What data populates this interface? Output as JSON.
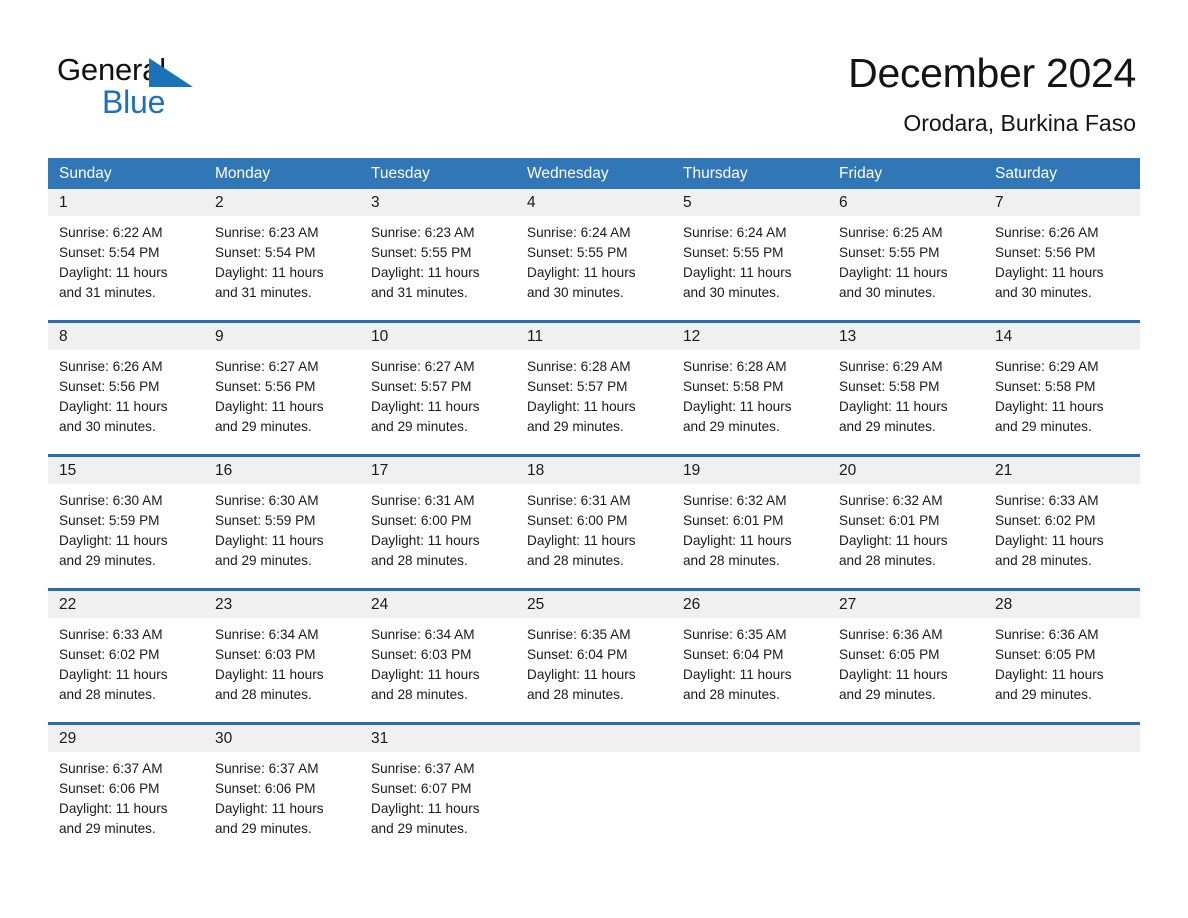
{
  "brand": {
    "word_black": "General",
    "word_blue": "Blue",
    "triangle_color": "#1b72b8",
    "logo_icon": "general-blue-triangle-logo"
  },
  "header": {
    "title": "December 2024",
    "subtitle": "Orodara, Burkina Faso"
  },
  "theme": {
    "header_blue": "#3176b6",
    "row_divider_blue": "#2b6cad",
    "day_band_gray": "#f0f0f0",
    "text": "#1a1a1a"
  },
  "weekdays": [
    "Sunday",
    "Monday",
    "Tuesday",
    "Wednesday",
    "Thursday",
    "Friday",
    "Saturday"
  ],
  "weeks": [
    [
      {
        "day": "1",
        "sunrise": "Sunrise: 6:22 AM",
        "sunset": "Sunset: 5:54 PM",
        "daylight_1": "Daylight: 11 hours",
        "daylight_2": "and 31 minutes."
      },
      {
        "day": "2",
        "sunrise": "Sunrise: 6:23 AM",
        "sunset": "Sunset: 5:54 PM",
        "daylight_1": "Daylight: 11 hours",
        "daylight_2": "and 31 minutes."
      },
      {
        "day": "3",
        "sunrise": "Sunrise: 6:23 AM",
        "sunset": "Sunset: 5:55 PM",
        "daylight_1": "Daylight: 11 hours",
        "daylight_2": "and 31 minutes."
      },
      {
        "day": "4",
        "sunrise": "Sunrise: 6:24 AM",
        "sunset": "Sunset: 5:55 PM",
        "daylight_1": "Daylight: 11 hours",
        "daylight_2": "and 30 minutes."
      },
      {
        "day": "5",
        "sunrise": "Sunrise: 6:24 AM",
        "sunset": "Sunset: 5:55 PM",
        "daylight_1": "Daylight: 11 hours",
        "daylight_2": "and 30 minutes."
      },
      {
        "day": "6",
        "sunrise": "Sunrise: 6:25 AM",
        "sunset": "Sunset: 5:55 PM",
        "daylight_1": "Daylight: 11 hours",
        "daylight_2": "and 30 minutes."
      },
      {
        "day": "7",
        "sunrise": "Sunrise: 6:26 AM",
        "sunset": "Sunset: 5:56 PM",
        "daylight_1": "Daylight: 11 hours",
        "daylight_2": "and 30 minutes."
      }
    ],
    [
      {
        "day": "8",
        "sunrise": "Sunrise: 6:26 AM",
        "sunset": "Sunset: 5:56 PM",
        "daylight_1": "Daylight: 11 hours",
        "daylight_2": "and 30 minutes."
      },
      {
        "day": "9",
        "sunrise": "Sunrise: 6:27 AM",
        "sunset": "Sunset: 5:56 PM",
        "daylight_1": "Daylight: 11 hours",
        "daylight_2": "and 29 minutes."
      },
      {
        "day": "10",
        "sunrise": "Sunrise: 6:27 AM",
        "sunset": "Sunset: 5:57 PM",
        "daylight_1": "Daylight: 11 hours",
        "daylight_2": "and 29 minutes."
      },
      {
        "day": "11",
        "sunrise": "Sunrise: 6:28 AM",
        "sunset": "Sunset: 5:57 PM",
        "daylight_1": "Daylight: 11 hours",
        "daylight_2": "and 29 minutes."
      },
      {
        "day": "12",
        "sunrise": "Sunrise: 6:28 AM",
        "sunset": "Sunset: 5:58 PM",
        "daylight_1": "Daylight: 11 hours",
        "daylight_2": "and 29 minutes."
      },
      {
        "day": "13",
        "sunrise": "Sunrise: 6:29 AM",
        "sunset": "Sunset: 5:58 PM",
        "daylight_1": "Daylight: 11 hours",
        "daylight_2": "and 29 minutes."
      },
      {
        "day": "14",
        "sunrise": "Sunrise: 6:29 AM",
        "sunset": "Sunset: 5:58 PM",
        "daylight_1": "Daylight: 11 hours",
        "daylight_2": "and 29 minutes."
      }
    ],
    [
      {
        "day": "15",
        "sunrise": "Sunrise: 6:30 AM",
        "sunset": "Sunset: 5:59 PM",
        "daylight_1": "Daylight: 11 hours",
        "daylight_2": "and 29 minutes."
      },
      {
        "day": "16",
        "sunrise": "Sunrise: 6:30 AM",
        "sunset": "Sunset: 5:59 PM",
        "daylight_1": "Daylight: 11 hours",
        "daylight_2": "and 29 minutes."
      },
      {
        "day": "17",
        "sunrise": "Sunrise: 6:31 AM",
        "sunset": "Sunset: 6:00 PM",
        "daylight_1": "Daylight: 11 hours",
        "daylight_2": "and 28 minutes."
      },
      {
        "day": "18",
        "sunrise": "Sunrise: 6:31 AM",
        "sunset": "Sunset: 6:00 PM",
        "daylight_1": "Daylight: 11 hours",
        "daylight_2": "and 28 minutes."
      },
      {
        "day": "19",
        "sunrise": "Sunrise: 6:32 AM",
        "sunset": "Sunset: 6:01 PM",
        "daylight_1": "Daylight: 11 hours",
        "daylight_2": "and 28 minutes."
      },
      {
        "day": "20",
        "sunrise": "Sunrise: 6:32 AM",
        "sunset": "Sunset: 6:01 PM",
        "daylight_1": "Daylight: 11 hours",
        "daylight_2": "and 28 minutes."
      },
      {
        "day": "21",
        "sunrise": "Sunrise: 6:33 AM",
        "sunset": "Sunset: 6:02 PM",
        "daylight_1": "Daylight: 11 hours",
        "daylight_2": "and 28 minutes."
      }
    ],
    [
      {
        "day": "22",
        "sunrise": "Sunrise: 6:33 AM",
        "sunset": "Sunset: 6:02 PM",
        "daylight_1": "Daylight: 11 hours",
        "daylight_2": "and 28 minutes."
      },
      {
        "day": "23",
        "sunrise": "Sunrise: 6:34 AM",
        "sunset": "Sunset: 6:03 PM",
        "daylight_1": "Daylight: 11 hours",
        "daylight_2": "and 28 minutes."
      },
      {
        "day": "24",
        "sunrise": "Sunrise: 6:34 AM",
        "sunset": "Sunset: 6:03 PM",
        "daylight_1": "Daylight: 11 hours",
        "daylight_2": "and 28 minutes."
      },
      {
        "day": "25",
        "sunrise": "Sunrise: 6:35 AM",
        "sunset": "Sunset: 6:04 PM",
        "daylight_1": "Daylight: 11 hours",
        "daylight_2": "and 28 minutes."
      },
      {
        "day": "26",
        "sunrise": "Sunrise: 6:35 AM",
        "sunset": "Sunset: 6:04 PM",
        "daylight_1": "Daylight: 11 hours",
        "daylight_2": "and 28 minutes."
      },
      {
        "day": "27",
        "sunrise": "Sunrise: 6:36 AM",
        "sunset": "Sunset: 6:05 PM",
        "daylight_1": "Daylight: 11 hours",
        "daylight_2": "and 29 minutes."
      },
      {
        "day": "28",
        "sunrise": "Sunrise: 6:36 AM",
        "sunset": "Sunset: 6:05 PM",
        "daylight_1": "Daylight: 11 hours",
        "daylight_2": "and 29 minutes."
      }
    ],
    [
      {
        "day": "29",
        "sunrise": "Sunrise: 6:37 AM",
        "sunset": "Sunset: 6:06 PM",
        "daylight_1": "Daylight: 11 hours",
        "daylight_2": "and 29 minutes."
      },
      {
        "day": "30",
        "sunrise": "Sunrise: 6:37 AM",
        "sunset": "Sunset: 6:06 PM",
        "daylight_1": "Daylight: 11 hours",
        "daylight_2": "and 29 minutes."
      },
      {
        "day": "31",
        "sunrise": "Sunrise: 6:37 AM",
        "sunset": "Sunset: 6:07 PM",
        "daylight_1": "Daylight: 11 hours",
        "daylight_2": "and 29 minutes."
      },
      {
        "day": "",
        "sunrise": "",
        "sunset": "",
        "daylight_1": "",
        "daylight_2": ""
      },
      {
        "day": "",
        "sunrise": "",
        "sunset": "",
        "daylight_1": "",
        "daylight_2": ""
      },
      {
        "day": "",
        "sunrise": "",
        "sunset": "",
        "daylight_1": "",
        "daylight_2": ""
      },
      {
        "day": "",
        "sunrise": "",
        "sunset": "",
        "daylight_1": "",
        "daylight_2": ""
      }
    ]
  ]
}
